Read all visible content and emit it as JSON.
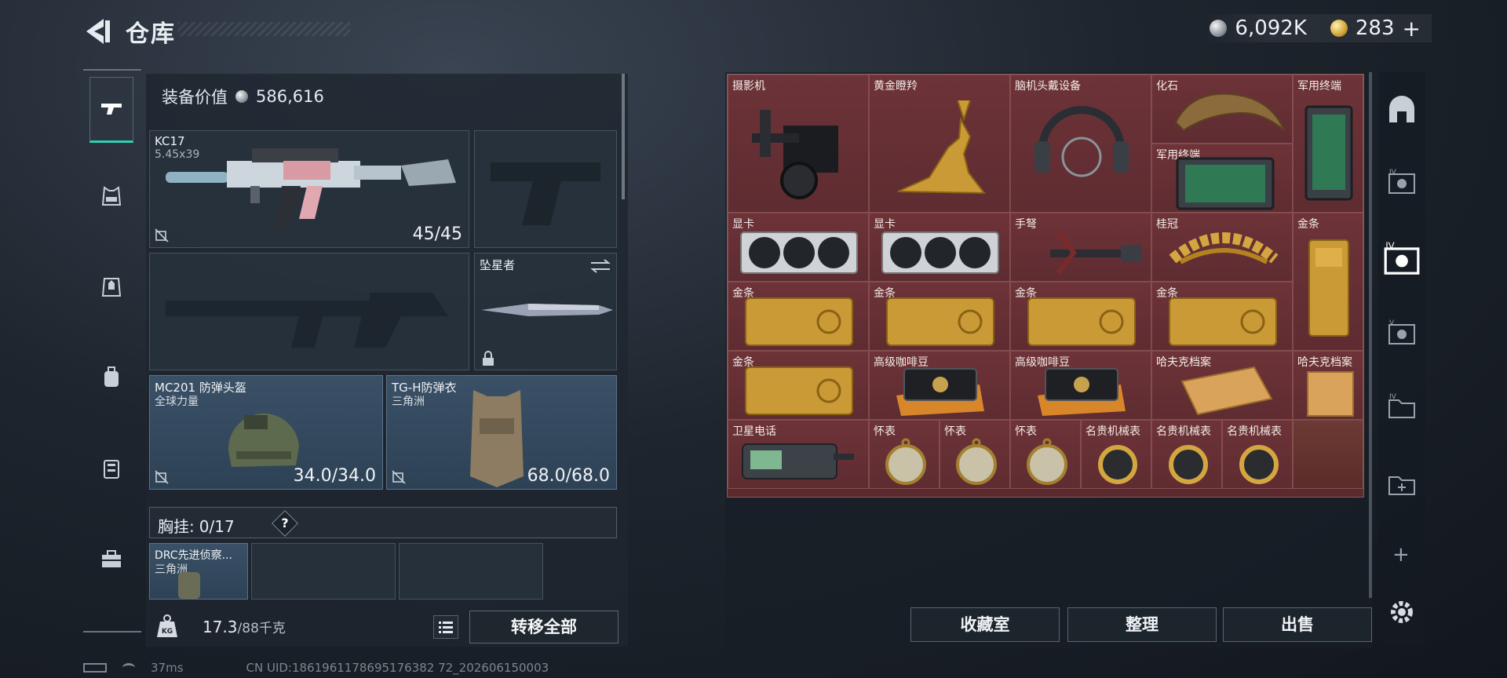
{
  "header": {
    "title": "仓库",
    "currency_silver": "6,092K",
    "currency_gold": "283",
    "gold_add": "+"
  },
  "equipment": {
    "value_label": "装备价值",
    "value": "586,616",
    "primary": {
      "name": "KC17",
      "caliber": "5.45x39",
      "ammo": "45/45"
    },
    "melee": {
      "name": "坠星者"
    },
    "helmet": {
      "name": "MC201 防弹头盔",
      "faction": "全球力量",
      "durability": "34.0/34.0"
    },
    "armor": {
      "name": "TG-H防弹衣",
      "faction": "三角洲",
      "durability": "68.0/68.0"
    },
    "chest": {
      "label": "胸挂:",
      "count": "0/17",
      "help": "?"
    },
    "backpack": {
      "name": "DRC先进侦察...",
      "faction": "三角洲"
    }
  },
  "footer": {
    "weight": "17.3",
    "weight_max": "/88千克",
    "transfer_all": "转移全部",
    "weight_icon_text": "KG"
  },
  "status": {
    "ping": "37ms",
    "uid": "CN UID:1861961178695176382 72_202606150003"
  },
  "storage": {
    "items": [
      {
        "label": "摄影机",
        "icon": "camera-icon"
      },
      {
        "label": "黄金瞪羚",
        "icon": "gold-gazelle-icon"
      },
      {
        "label": "脑机头戴设备",
        "icon": "headset-icon"
      },
      {
        "label": "化石",
        "icon": "fossil-icon"
      },
      {
        "label": "军用终端",
        "icon": "terminal-icon"
      },
      {
        "label": "军用终端",
        "icon": "terminal-icon"
      },
      {
        "label": "显卡",
        "icon": "gpu-icon"
      },
      {
        "label": "显卡",
        "icon": "gpu-icon"
      },
      {
        "label": "手弩",
        "icon": "crossbow-icon"
      },
      {
        "label": "桂冠",
        "icon": "laurel-icon"
      },
      {
        "label": "金条",
        "icon": "gold-bar-icon"
      },
      {
        "label": "金条",
        "icon": "gold-bar-icon"
      },
      {
        "label": "金条",
        "icon": "gold-bar-icon"
      },
      {
        "label": "金条",
        "icon": "gold-bar-icon"
      },
      {
        "label": "金条",
        "icon": "gold-bar-icon"
      },
      {
        "label": "金条",
        "icon": "gold-bar-icon"
      },
      {
        "label": "高级咖啡豆",
        "icon": "coffee-icon"
      },
      {
        "label": "高级咖啡豆",
        "icon": "coffee-icon"
      },
      {
        "label": "哈夫克档案",
        "icon": "file-icon"
      },
      {
        "label": "哈夫克档案",
        "icon": "file-icon"
      },
      {
        "label": "卫星电话",
        "icon": "sat-phone-icon"
      },
      {
        "label": "怀表",
        "icon": "pocket-watch-icon"
      },
      {
        "label": "怀表",
        "icon": "pocket-watch-icon"
      },
      {
        "label": "怀表",
        "icon": "pocket-watch-icon"
      },
      {
        "label": "名贵机械表",
        "icon": "wristwatch-icon"
      },
      {
        "label": "名贵机械表",
        "icon": "wristwatch-icon"
      },
      {
        "label": "名贵机械表",
        "icon": "wristwatch-icon"
      }
    ],
    "collection_room": "收藏室",
    "sort": "整理",
    "sell": "出售",
    "add": "+"
  },
  "colors": {
    "accent": "#2fd0b4",
    "item_background": "#6d3338",
    "panel": "#1e262f"
  }
}
